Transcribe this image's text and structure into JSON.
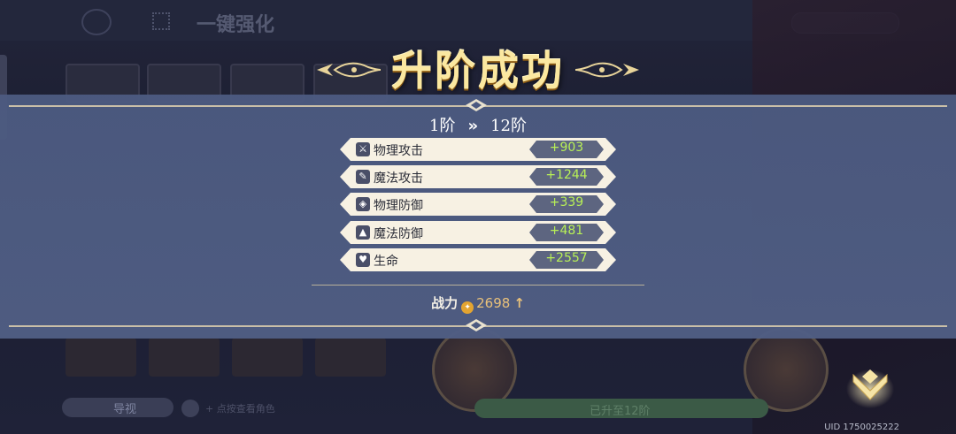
{
  "background": {
    "title": "一键强化",
    "left_button": "导视",
    "hint": "+ 点按查看角色",
    "green_button": "已升至12阶"
  },
  "popup": {
    "title": "升阶成功",
    "rank_from": "1阶",
    "rank_arrow": "»",
    "rank_to": "12阶",
    "stats": [
      {
        "icon": "sword-icon",
        "label": "物理攻击",
        "value": "+903"
      },
      {
        "icon": "wand-icon",
        "label": "魔法攻击",
        "value": "+1244"
      },
      {
        "icon": "shield-icon",
        "label": "物理防御",
        "value": "+339"
      },
      {
        "icon": "wizard-hat-icon",
        "label": "魔法防御",
        "value": "+481"
      },
      {
        "icon": "heart-icon",
        "label": "生命",
        "value": "+2557"
      }
    ],
    "power_label": "战力",
    "power_value": "2698",
    "power_arrow": "↑"
  },
  "uid": "UID 1750025222",
  "colors": {
    "panel": "#4c5a80",
    "title_gold": "#fbe8a0",
    "stat_value": "#b8f056",
    "power_value": "#e9c17a"
  }
}
